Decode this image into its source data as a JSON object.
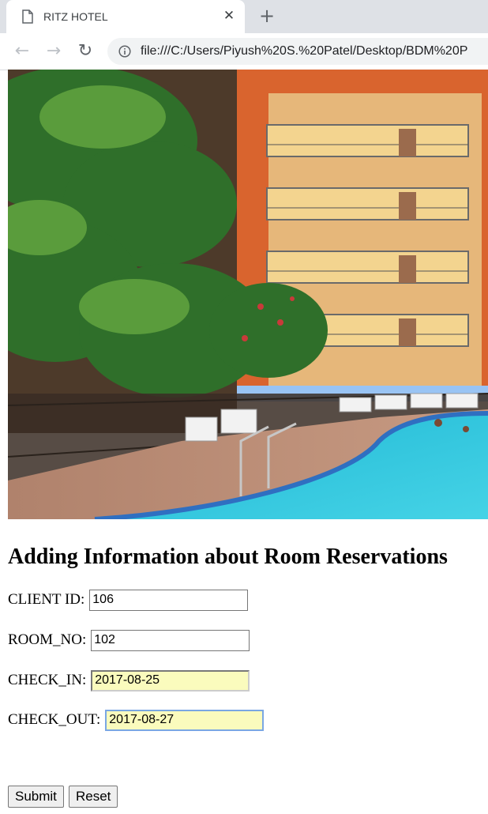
{
  "browser": {
    "tab_title": "RITZ HOTEL",
    "url": "file:///C:/Users/Piyush%20S.%20Patel/Desktop/BDM%20P",
    "close_glyph": "✕",
    "new_tab_glyph": "+",
    "back_glyph": "←",
    "forward_glyph": "→",
    "reload_glyph": "↻"
  },
  "page": {
    "heading": "Adding Information about Room Reservations",
    "fields": [
      {
        "label": "CLIENT ID:",
        "value": "106"
      },
      {
        "label": "ROOM_NO:",
        "value": "102"
      },
      {
        "label": "CHECK_IN:",
        "value": "2017-08-25"
      },
      {
        "label": "CHECK_OUT:",
        "value": "2017-08-27"
      }
    ],
    "submit_label": "Submit",
    "reset_label": "Reset"
  },
  "colors": {
    "autofill_bg": "#fafbbd",
    "focus_border": "#7aa7e3",
    "pool_water": "#26c3d9",
    "building_orange": "#d9642e"
  }
}
